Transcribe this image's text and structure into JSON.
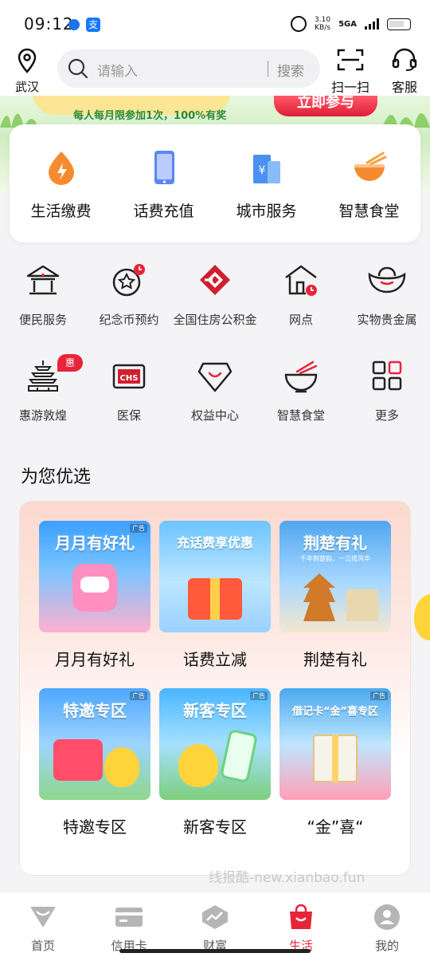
{
  "status": {
    "time": "09:12",
    "speed_top": "3.10",
    "speed_bottom": "KB/s",
    "network": "5GA",
    "app_icon_2": "支"
  },
  "topnav": {
    "location": "武汉",
    "search_placeholder": "请输入",
    "search_button": "搜索",
    "scan_label": "扫一扫",
    "service_label": "客服"
  },
  "banner": {
    "text": "每人每月限参加1次，100%有奖",
    "cta": "立即参与"
  },
  "services": [
    {
      "label": "生活缴费",
      "icon": "droplet-lightning-icon"
    },
    {
      "label": "话费充值",
      "icon": "phone-icon"
    },
    {
      "label": "城市服务",
      "icon": "city-building-icon"
    },
    {
      "label": "智慧食堂",
      "icon": "noodle-bowl-icon"
    }
  ],
  "grid": [
    {
      "label": "便民服务",
      "icon": "house-service-icon"
    },
    {
      "label": "纪念币预约",
      "icon": "coin-clock-icon"
    },
    {
      "label": "全国住房公积金",
      "icon": "housing-fund-icon"
    },
    {
      "label": "网点",
      "icon": "branch-clock-icon"
    },
    {
      "label": "实物贵金属",
      "icon": "gold-ingot-icon"
    },
    {
      "label": "惠游敦煌",
      "icon": "pagoda-icon",
      "badge": "惠"
    },
    {
      "label": "医保",
      "icon": "chs-card-icon"
    },
    {
      "label": "权益中心",
      "icon": "diamond-smile-icon"
    },
    {
      "label": "智慧食堂",
      "icon": "bowl-chopsticks-icon"
    },
    {
      "label": "更多",
      "icon": "more-grid-icon"
    }
  ],
  "section_title": "为您优选",
  "promos": [
    {
      "label": "月月有好礼",
      "head": "月月有好礼",
      "ad": "广告"
    },
    {
      "label": "话费立减",
      "head": "充话费享优惠",
      "ad": ""
    },
    {
      "label": "荆楚有礼",
      "head": "荆楚有礼",
      "sub": "千年荆楚韵，一江揽风华",
      "ad": ""
    },
    {
      "label": "特邀专区",
      "head": "特邀专区",
      "ad": "广告"
    },
    {
      "label": "新客专区",
      "head": "新客专区",
      "ad": "广告"
    },
    {
      "label": "“金”喜“",
      "head": "借记卡“金”喜专区",
      "ad": "广告"
    }
  ],
  "watermark": "线报酷-new.xianbao.fun",
  "tabs": [
    {
      "label": "首页",
      "icon": "home-diamond-icon"
    },
    {
      "label": "信用卡",
      "icon": "credit-card-icon"
    },
    {
      "label": "财富",
      "icon": "wealth-chart-icon"
    },
    {
      "label": "生活",
      "icon": "shopping-bag-icon",
      "active": true
    },
    {
      "label": "我的",
      "icon": "user-icon"
    }
  ],
  "colors": {
    "accent": "#e8243b",
    "orange": "#f27a2a",
    "blue": "#4a7cf5",
    "tab_inactive": "#b5b5b5"
  }
}
